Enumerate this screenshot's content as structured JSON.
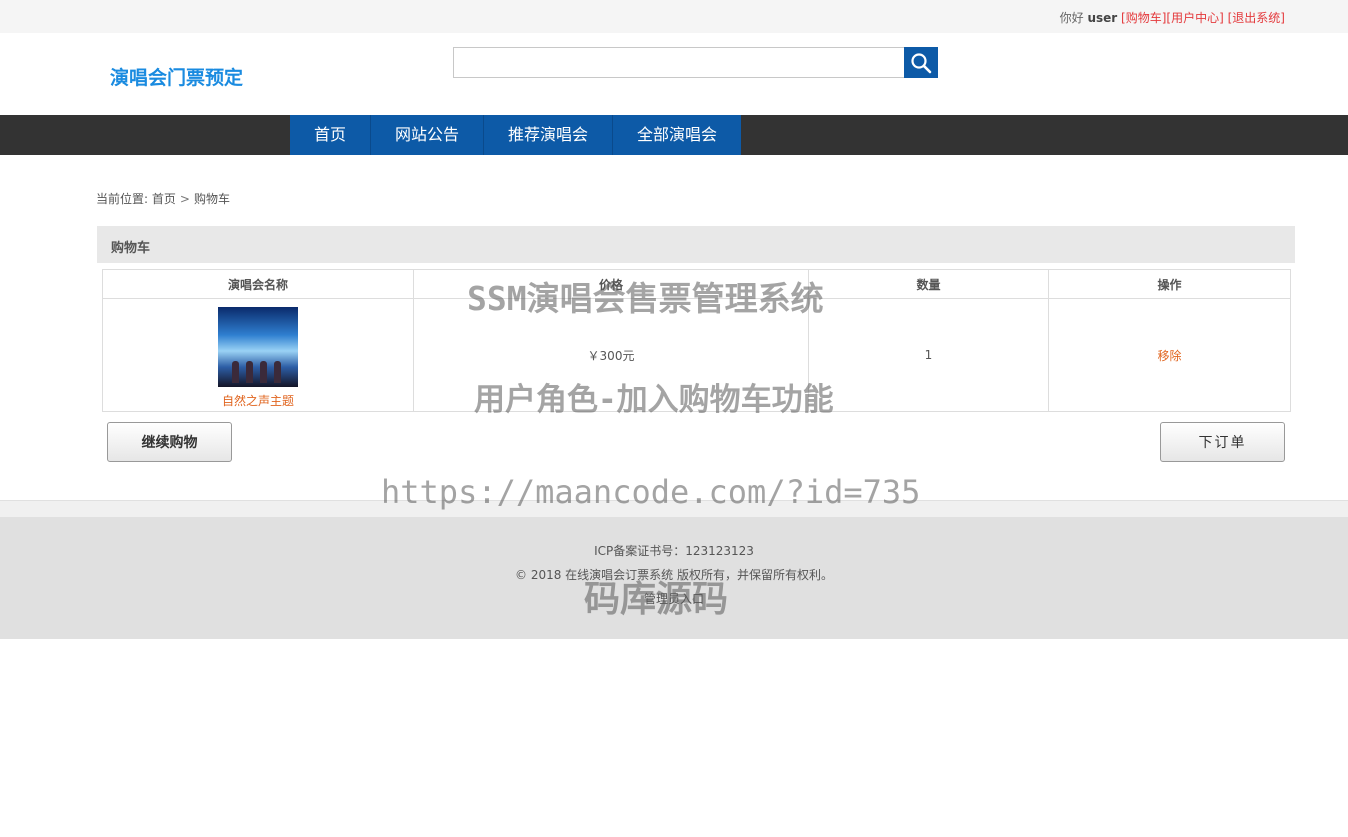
{
  "topbar": {
    "greeting": "你好",
    "username": "user",
    "cart_link": "[购物车]",
    "user_center_link": "[用户中心]",
    "logout_link": "[退出系统]"
  },
  "logo": {
    "text": "演唱会门票预定"
  },
  "search": {
    "value": "",
    "placeholder": ""
  },
  "nav": {
    "items": [
      {
        "label": "首页"
      },
      {
        "label": "网站公告"
      },
      {
        "label": "推荐演唱会"
      },
      {
        "label": "全部演唱会"
      }
    ]
  },
  "breadcrumb": {
    "prefix": "当前位置:",
    "home": "首页",
    "sep": ">",
    "current": "购物车"
  },
  "panel": {
    "title": "购物车"
  },
  "cart": {
    "headers": [
      "演唱会名称",
      "价格",
      "数量",
      "操作"
    ],
    "rows": [
      {
        "name": "自然之声主题",
        "price": "￥300元",
        "quantity": "1",
        "action": "移除"
      }
    ]
  },
  "buttons": {
    "continue": "继续购物",
    "order": "下订单"
  },
  "footer": {
    "icp": "ICP备案证书号：123123123",
    "copyright": "© 2018 在线演唱会订票系统 版权所有，并保留所有权利。",
    "admin_link": "管理员入口"
  },
  "watermarks": {
    "title": "SSM演唱会售票管理系统",
    "subtitle": "用户角色-加入购物车功能",
    "url": "https://maancode.com/?id=735",
    "brand": "码库源码"
  },
  "colors": {
    "brand_blue": "#0d5aa7",
    "logo_blue": "#1a8be0",
    "link_red": "#e4393c",
    "accent_orange": "#e0641e",
    "nav_dark": "#333333"
  }
}
